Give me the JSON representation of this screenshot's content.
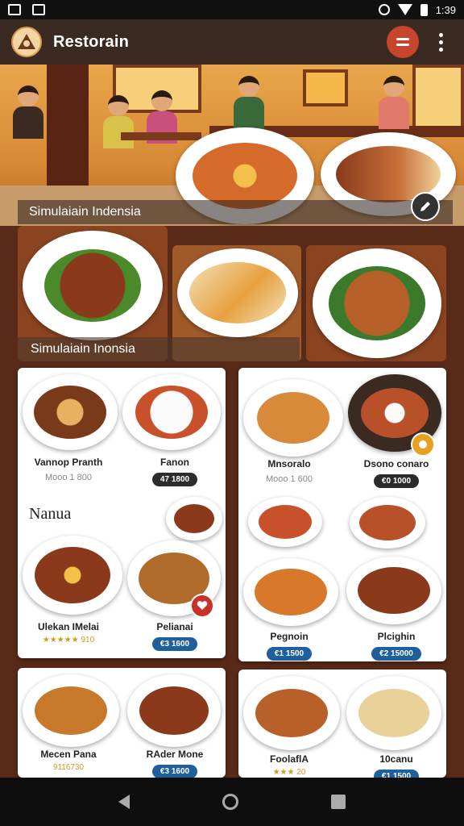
{
  "status_bar": {
    "time": "1:39"
  },
  "app_bar": {
    "title": "Restorain"
  },
  "hero": {
    "caption": "Simulaiain Indensia"
  },
  "strip": {
    "caption": "Simulaiain Inonsia"
  },
  "colors": {
    "appbar": "#3b2a22",
    "accent": "#c8452d",
    "price_dark": "#2c2c2c",
    "price_blue": "#1f5f9c"
  },
  "cards": {
    "card1": {
      "dish1": {
        "name": "Vannop Pranth",
        "sub": "Mooo 1 800"
      },
      "dish2": {
        "name": "Fanon",
        "price": "47 1800"
      },
      "section": "Nanua",
      "dish3": {
        "name": "Ulekan IMelai",
        "stars": "★★★★★ 910"
      },
      "dish4": {
        "name": "Pelianai",
        "price": "€3 1600"
      }
    },
    "card2": {
      "dish1": {
        "name": "Mnsoralo",
        "sub": "Mooo 1 600"
      },
      "dish2": {
        "name": "Dsono conaro",
        "price": "€0 1000"
      },
      "dish3": {
        "name": "Pegnoin",
        "price": "€1 1500"
      },
      "dish4": {
        "name": "Plcighin",
        "price": "€2 15000"
      }
    },
    "card3": {
      "dish1": {
        "name": "Mecen Pana",
        "stars": "9116730"
      },
      "dish2": {
        "name": "RAder Mone",
        "price": "€3 1600"
      }
    },
    "card4": {
      "dish1": {
        "name": "FoolaflA",
        "stars": "★★★ 20"
      },
      "dish2": {
        "name": "10canu",
        "price": "€1 1500"
      }
    }
  },
  "icons": [
    "signal-icon",
    "photo-icon",
    "wifi-icon",
    "battery-icon",
    "logo-icon",
    "menu-icon",
    "more-vert-icon",
    "edit-icon",
    "back-icon",
    "home-icon",
    "recents-icon"
  ]
}
